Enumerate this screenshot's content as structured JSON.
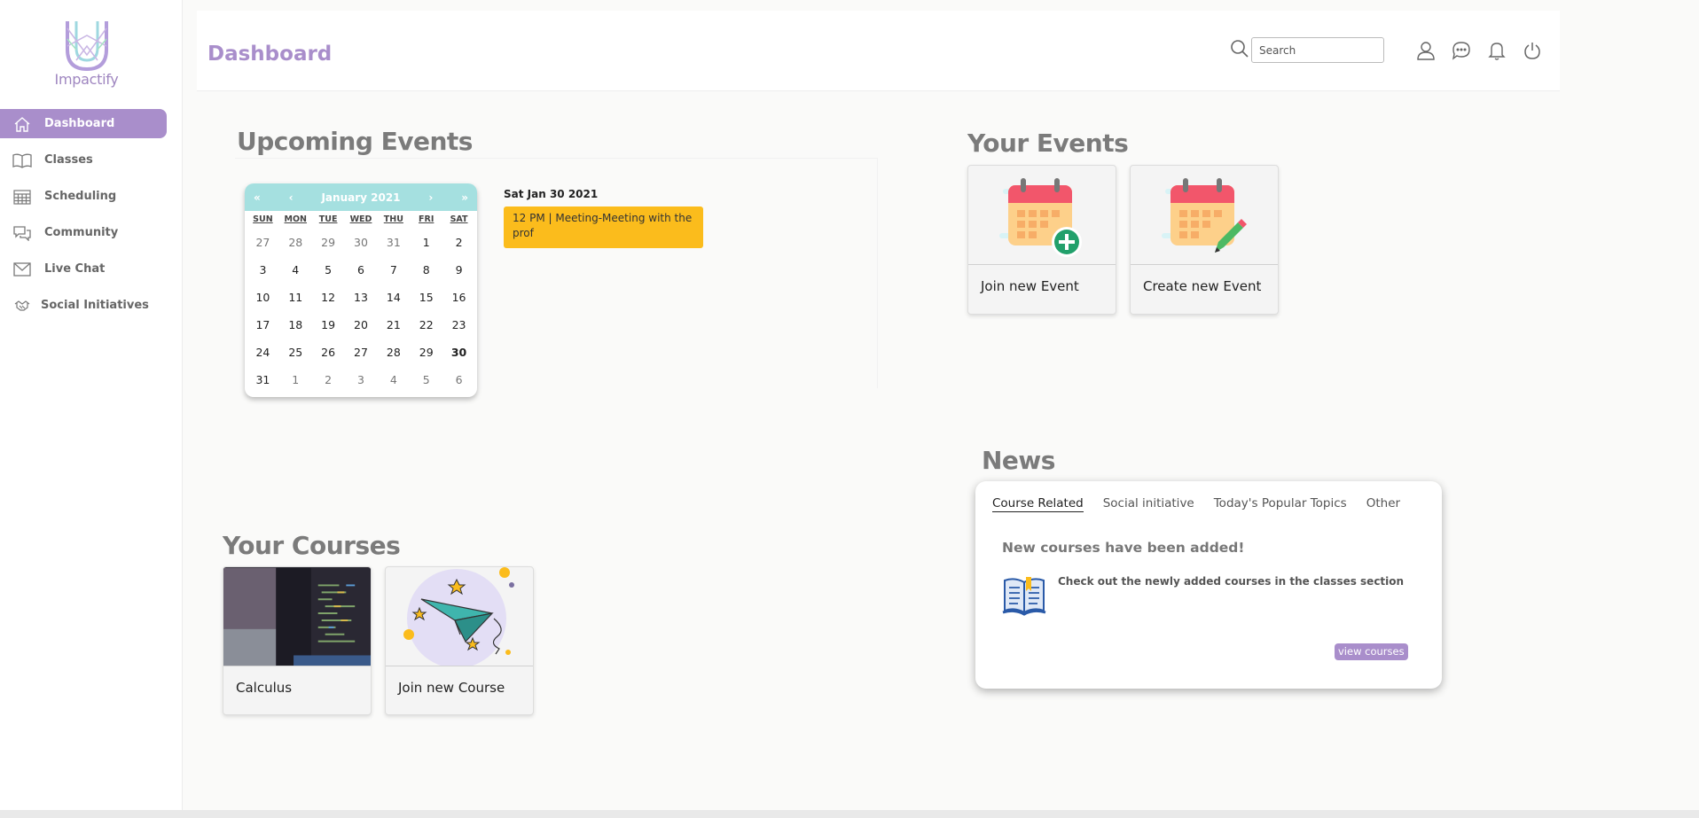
{
  "app": {
    "name": "Impactify"
  },
  "sidebar": {
    "items": [
      {
        "label": "Dashboard",
        "icon": "home-icon",
        "active": true
      },
      {
        "label": "Classes",
        "icon": "book-icon"
      },
      {
        "label": "Scheduling",
        "icon": "calendar-grid-icon"
      },
      {
        "label": "Community",
        "icon": "chat-bubbles-icon"
      },
      {
        "label": "Live Chat",
        "icon": "mail-icon"
      },
      {
        "label": "Social Initiatives",
        "icon": "handshake-icon"
      }
    ]
  },
  "header": {
    "title": "Dashboard",
    "search_placeholder": "Search",
    "icons": [
      "user-icon",
      "message-icon",
      "bell-icon",
      "power-icon"
    ]
  },
  "upcoming": {
    "title": "Upcoming Events",
    "calendar": {
      "month_label": "January 2021",
      "nav": {
        "prev_year": "«",
        "prev_month": "‹",
        "next_month": "›",
        "next_year": "»"
      },
      "weekdays": [
        "SUN",
        "MON",
        "TUE",
        "WED",
        "THU",
        "FRI",
        "SAT"
      ],
      "days": [
        [
          "27",
          "28",
          "29",
          "30",
          "31",
          "1",
          "2"
        ],
        [
          "3",
          "4",
          "5",
          "6",
          "7",
          "8",
          "9"
        ],
        [
          "10",
          "11",
          "12",
          "13",
          "14",
          "15",
          "16"
        ],
        [
          "17",
          "18",
          "19",
          "20",
          "21",
          "22",
          "23"
        ],
        [
          "24",
          "25",
          "26",
          "27",
          "28",
          "29",
          "30"
        ],
        [
          "31",
          "1",
          "2",
          "3",
          "4",
          "5",
          "6"
        ]
      ],
      "selected": "30"
    },
    "selected_date": "Sat Jan 30 2021",
    "event": "12 PM | Meeting-Meeting with the prof"
  },
  "your_events": {
    "title": "Your Events",
    "cards": [
      {
        "label": "Join new Event",
        "icon": "calendar-add-icon"
      },
      {
        "label": "Create new Event",
        "icon": "calendar-edit-icon"
      }
    ]
  },
  "your_courses": {
    "title": "Your Courses",
    "cards": [
      {
        "label": "Calculus",
        "image": "code-screen-photo"
      },
      {
        "label": "Join new Course",
        "image": "paper-plane-icon"
      }
    ]
  },
  "news": {
    "title": "News",
    "tabs": [
      "Course Related",
      "Social initiative",
      "Today's Popular Topics",
      "Other"
    ],
    "active_tab": "Course Related",
    "headline": "New courses have been added!",
    "body": "Check out the newly added courses in the classes section",
    "button": "view courses"
  },
  "colors": {
    "accent": "#a98ecb",
    "calendar_header": "#a5e0e0",
    "event_chip": "#fbbc1c"
  }
}
